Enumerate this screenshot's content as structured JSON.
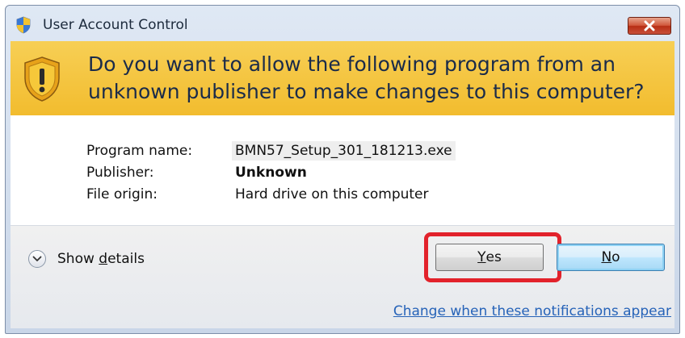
{
  "window": {
    "title": "User Account Control"
  },
  "banner": {
    "question": "Do you want to allow the following program from an unknown publisher to make changes to this computer?"
  },
  "details": {
    "program_label": "Program name:",
    "program_value": "BMN57_Setup_301_181213.exe",
    "publisher_label": "Publisher:",
    "publisher_value": "Unknown",
    "origin_label": "File origin:",
    "origin_value": "Hard drive on this computer"
  },
  "footer": {
    "show_details_prefix": "Show ",
    "show_details_accel": "d",
    "show_details_rest": "etails",
    "yes_accel": "Y",
    "yes_rest": "es",
    "no_accel": "N",
    "no_rest": "o",
    "notifications_link": "Change when these notifications appear"
  },
  "icons": {
    "title": "uac-shield-icon",
    "banner": "warning-shield-icon",
    "close": "close-icon",
    "expand": "chevron-down-icon"
  },
  "colors": {
    "banner": "#f2bc2e",
    "highlight": "#e2222b",
    "link": "#2663b8",
    "close_button": "#c9503a"
  }
}
